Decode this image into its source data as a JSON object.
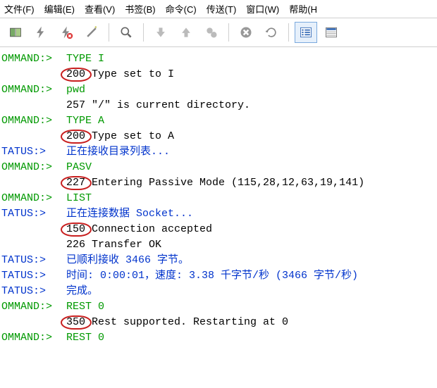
{
  "menu": {
    "items": [
      "文件(F)",
      "编辑(E)",
      "查看(V)",
      "书签(B)",
      "命令(C)",
      "传送(T)",
      "窗口(W)",
      "帮助(H"
    ]
  },
  "toolbar": {
    "buttons": [
      {
        "name": "open-book-icon"
      },
      {
        "name": "lightning-icon"
      },
      {
        "name": "lightning-cancel-icon"
      },
      {
        "name": "wand-icon"
      },
      {
        "sep": true
      },
      {
        "name": "zoom-icon"
      },
      {
        "sep": true
      },
      {
        "name": "arrow-down-icon"
      },
      {
        "name": "arrow-up-icon"
      },
      {
        "name": "gear-pair-icon"
      },
      {
        "sep": true
      },
      {
        "name": "stop-x-icon"
      },
      {
        "name": "refresh-icon"
      },
      {
        "sep": true
      },
      {
        "name": "list-view-icon",
        "selected": true
      },
      {
        "name": "details-view-icon"
      }
    ]
  },
  "log": [
    {
      "tag": "OMMAND:>",
      "tagcolor": "green",
      "text": "TYPE I",
      "color": "green"
    },
    {
      "tag": "",
      "tagcolor": "",
      "text": "200 Type set to I",
      "color": "black",
      "circle": true
    },
    {
      "tag": "OMMAND:>",
      "tagcolor": "green",
      "text": "pwd",
      "color": "green"
    },
    {
      "tag": "",
      "tagcolor": "",
      "text": "257 \"/\" is current directory.",
      "color": "black"
    },
    {
      "tag": "OMMAND:>",
      "tagcolor": "green",
      "text": "TYPE A",
      "color": "green"
    },
    {
      "tag": "",
      "tagcolor": "",
      "text": "200 Type set to A",
      "color": "black",
      "circle": true
    },
    {
      "tag": "TATUS:>",
      "tagcolor": "blue",
      "text": "正在接收目录列表...",
      "color": "blue"
    },
    {
      "tag": "OMMAND:>",
      "tagcolor": "green",
      "text": "PASV",
      "color": "green"
    },
    {
      "tag": "",
      "tagcolor": "",
      "text": "227 Entering Passive Mode (115,28,12,63,19,141)",
      "color": "black",
      "circle": true
    },
    {
      "tag": "OMMAND:>",
      "tagcolor": "green",
      "text": "LIST",
      "color": "green"
    },
    {
      "tag": "TATUS:>",
      "tagcolor": "blue",
      "text": "正在连接数据 Socket...",
      "color": "blue"
    },
    {
      "tag": "",
      "tagcolor": "",
      "text": "150 Connection accepted",
      "color": "black",
      "circle": true
    },
    {
      "tag": "",
      "tagcolor": "",
      "text": "226 Transfer OK",
      "color": "black"
    },
    {
      "tag": "TATUS:>",
      "tagcolor": "blue",
      "text": "已顺利接收 3466 字节。",
      "color": "blue"
    },
    {
      "tag": "TATUS:>",
      "tagcolor": "blue",
      "text": "时间: 0:00:01，速度: 3.38 千字节/秒 (3466 字节/秒)",
      "color": "blue"
    },
    {
      "tag": "TATUS:>",
      "tagcolor": "blue",
      "text": "完成。",
      "color": "blue"
    },
    {
      "tag": "OMMAND:>",
      "tagcolor": "green",
      "text": "REST 0",
      "color": "green"
    },
    {
      "tag": "",
      "tagcolor": "",
      "text": "350 Rest supported. Restarting at 0",
      "color": "black",
      "circle": true
    },
    {
      "tag": "OMMAND:>",
      "tagcolor": "green",
      "text": "REST 0",
      "color": "green"
    }
  ]
}
